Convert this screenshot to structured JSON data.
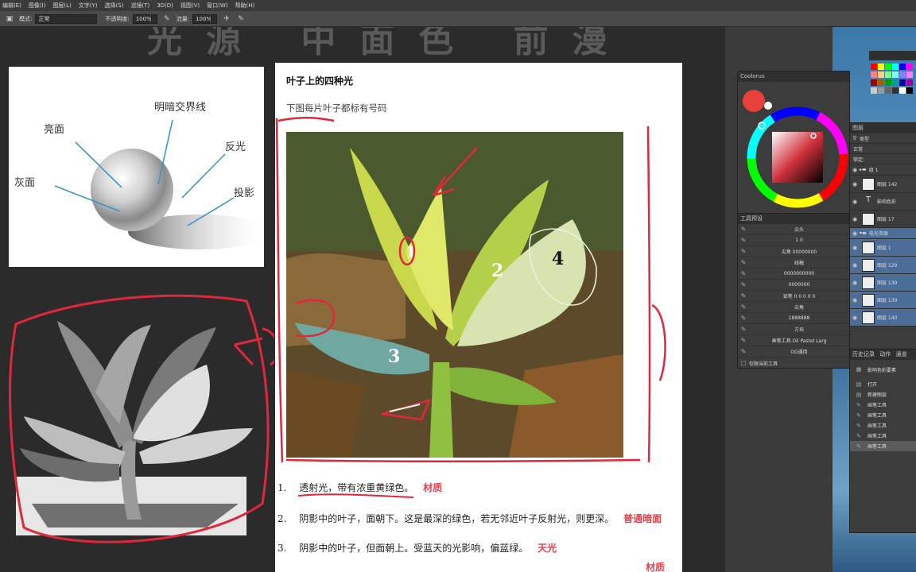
{
  "menu": [
    "编辑(E)",
    "图像(I)",
    "图层(L)",
    "文字(Y)",
    "选择(S)",
    "滤镜(T)",
    "3D(D)",
    "视图(V)",
    "窗口(W)",
    "帮助(H)"
  ],
  "options": {
    "mode_label": "模式:",
    "mode_value": "正常",
    "opacity_label": "不透明度:",
    "opacity_value": "100%",
    "flow_label": "流量:",
    "flow_value": "100%"
  },
  "canvas": {
    "ghost_title": "光源 中面色 前漫",
    "sphere_labels": {
      "terminator": "明暗交界线",
      "highlight": "亮面",
      "reflected": "反光",
      "gray": "灰面",
      "shadow": "投影"
    }
  },
  "doc": {
    "heading": "叶子上的四种光",
    "subheading": "下图每片叶子都标有号码",
    "items": [
      {
        "num": "1.",
        "text": "透射光，带有浓重黄绿色。",
        "tag": "材质"
      },
      {
        "num": "2.",
        "text": "阴影中的叶子，面朝下。这是最深的绿色，若无邻近叶子反射光，则更深。",
        "tag": "普通暗面"
      },
      {
        "num": "3.",
        "text": "阴影中的叶子，但面朝上。受蓝天的光影响，偏蓝绿。",
        "tag": "天光"
      }
    ],
    "tail_tag": "材质",
    "leaf_numbers": [
      "1",
      "2",
      "3",
      "4"
    ]
  },
  "panels": {
    "coolorus_title": "Coolorus",
    "brush_title": "工具预设",
    "brush_rows": [
      "尖头",
      "1   0",
      "尖角 00000000",
      "线稿",
      "0000000000",
      "0000000",
      "铅笔 0 0 0 0 0",
      "尖角",
      "1888888",
      "方块",
      "画笔工具 Oil Pastel Larg",
      "OG通用"
    ],
    "brush_footer": "仅限当前工具",
    "layers_title": "图层",
    "layers_filter": "类型",
    "layers_mode": "正常",
    "layers_lock": "锁定:",
    "layer_rows": [
      "组 1",
      "图层 142",
      "影响色彩",
      "图层 17",
      "电光资源",
      "图层 1",
      "图层 129",
      "图层 139",
      "图层 139",
      "图层 140"
    ],
    "history_title": "历史记录",
    "history_tabs": [
      "历史记录",
      "动作",
      "通道"
    ],
    "history_snapshot": "影响色彩要素",
    "history_rows": [
      "打开",
      "新建图层",
      "画笔工具",
      "画笔工具",
      "画笔工具",
      "画笔工具",
      "画笔工具"
    ]
  },
  "colors": {
    "red_annotation": "#e0283c",
    "foreground": "#e8403a",
    "layer_selected": "#4d6d99"
  }
}
